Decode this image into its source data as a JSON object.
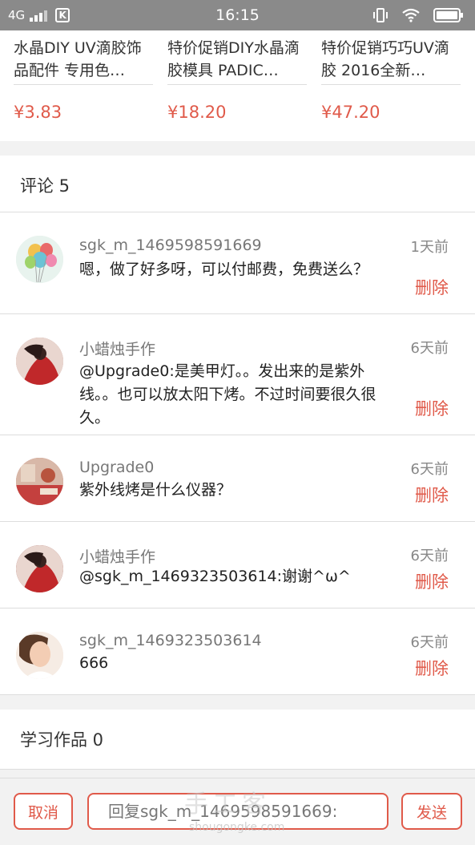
{
  "status_bar": {
    "network": "4G",
    "carrier_badge": "K",
    "time": "16:15",
    "icons": [
      "signal-icon",
      "vibrate-icon",
      "wifi-icon",
      "battery-icon"
    ]
  },
  "products": [
    {
      "name": "水晶DIY UV滴胶饰品配件 专用色…",
      "price": "¥3.83"
    },
    {
      "name": "特价促销DIY水晶滴胶模具 PADIC…",
      "price": "¥18.20"
    },
    {
      "name": "特价促销巧巧UV滴胶 2016全新…",
      "price": "¥47.20"
    }
  ],
  "comments_section": {
    "title": "评论 5",
    "delete_label": "删除",
    "items": [
      {
        "user": "sgk_m_1469598591669",
        "time": "1天前",
        "text": "嗯，做了好多呀，可以付邮费，免费送么？",
        "avatar": "balloons-avatar"
      },
      {
        "user": "小蜡烛手作",
        "time": "6天前",
        "text": "@Upgrade0:是美甲灯。。发出来的是紫外线。。也可以放太阳下烤。不过时间要很久很久。",
        "avatar": "red-dress-avatar"
      },
      {
        "user": "Upgrade0",
        "time": "6天前",
        "text": "紫外线烤是什么仪器？",
        "avatar": "room-avatar"
      },
      {
        "user": "小蜡烛手作",
        "time": "6天前",
        "text": "@sgk_m_1469323503614:谢谢^ω^",
        "avatar": "red-dress-avatar"
      },
      {
        "user": "sgk_m_1469323503614",
        "time": "6天前",
        "text": "666",
        "avatar": "portrait-avatar"
      }
    ]
  },
  "works_section": {
    "title": "学习作品 0"
  },
  "reply_bar": {
    "cancel_label": "取消",
    "placeholder": "回复sgk_m_1469598591669:",
    "send_label": "发送"
  },
  "watermark": {
    "text": "手工客",
    "url_text": "shougongke.com"
  },
  "colors": {
    "accent": "#e05a4a",
    "status_bar": "#8a8a8a",
    "background": "#f2f2f2"
  }
}
